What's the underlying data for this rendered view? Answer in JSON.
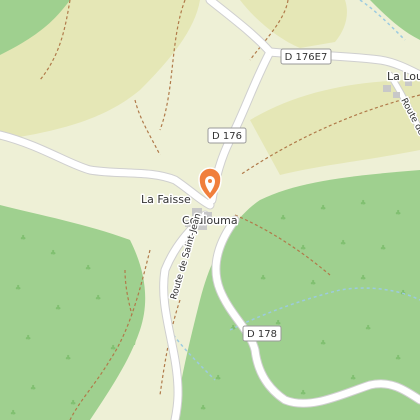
{
  "map": {
    "colors": {
      "base": "#eef0d6",
      "meadow": "#e5e7b6",
      "forest": "#9fd08f",
      "forest_dark": "#8fc47f",
      "road": "#ffffff",
      "road_casing": "#cfcfcf",
      "track": "#b07a4a",
      "stream": "#9ccbe0",
      "building": "#c8c8c8",
      "marker": "#f07f3c"
    },
    "places": {
      "la_faisse": "La Faisse",
      "coulouma": "Coulouma",
      "la_lou": "La Lou"
    },
    "roads": {
      "d176e7": "D 176E7",
      "d176": "D 176",
      "d178": "D 178",
      "route_saint_jean": "Route de Saint-Jean",
      "route_saint_right": "Route de Saint-C"
    },
    "marker_icon": "location-pin-icon"
  }
}
